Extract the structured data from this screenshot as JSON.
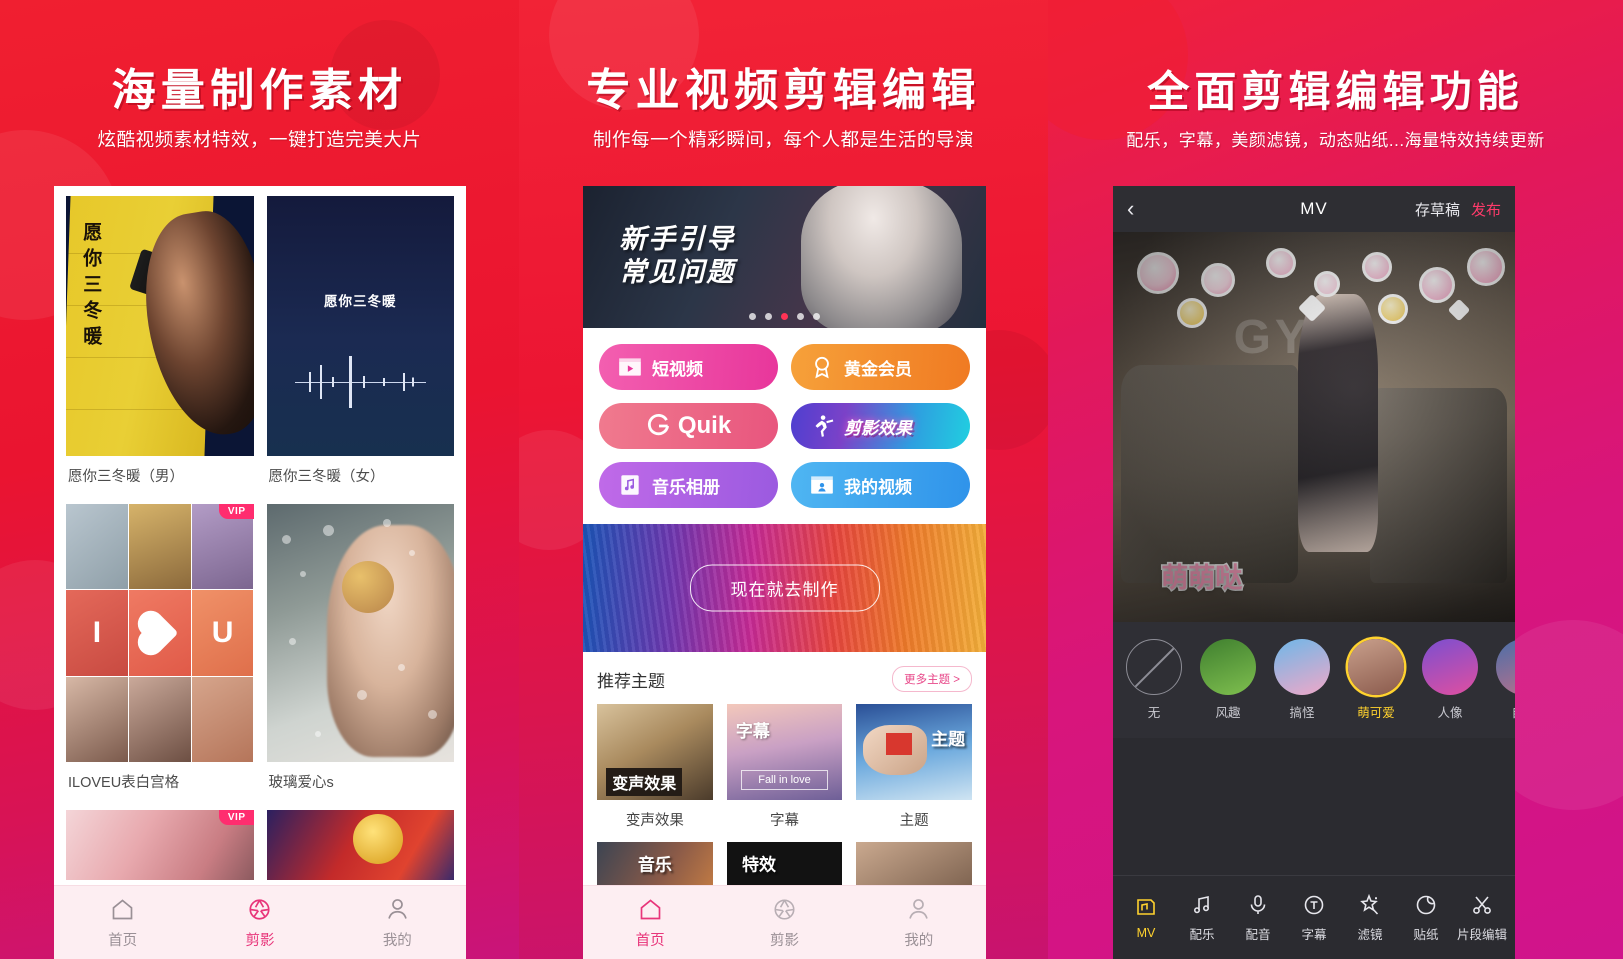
{
  "panels": [
    {
      "title": "海量制作素材",
      "subtitle": "炫酷视频素材特效，一键打造完美大片"
    },
    {
      "title": "专业视频剪辑编辑",
      "subtitle": "制作每一个精彩瞬间，每个人都是生活的导演"
    },
    {
      "title": "全面剪辑编辑功能",
      "subtitle": "配乐，字幕，美颜滤镜，动态贴纸...海量特效持续更新"
    }
  ],
  "phone1": {
    "cards": [
      {
        "caption": "愿你三冬暖（男）",
        "vip": ""
      },
      {
        "caption": "愿你三冬暖（女）",
        "vip": ""
      },
      {
        "caption": "ILOVEU表白宫格",
        "vip": "VIP"
      },
      {
        "caption": "玻璃爱心s",
        "vip": ""
      }
    ],
    "wave_title": "愿你三冬暖",
    "calligraphy": "愿你三冬暖",
    "collage_letters": [
      "I",
      "U"
    ],
    "partial_cards": [
      {
        "vip": "VIP"
      },
      {
        "vip": ""
      }
    ],
    "tabs": [
      {
        "label": "首页",
        "icon": "home-icon",
        "active": false
      },
      {
        "label": "剪影",
        "icon": "aperture-icon",
        "active": true
      },
      {
        "label": "我的",
        "icon": "user-icon",
        "active": false
      }
    ]
  },
  "phone2": {
    "banner": {
      "line1": "新手引导",
      "line2": "常见问题",
      "dots": 5,
      "active_dot": 3
    },
    "buttons": [
      {
        "label": "短视频",
        "icon": "video-clapper-icon",
        "style": "b-pink"
      },
      {
        "label": "黄金会员",
        "icon": "medal-icon",
        "style": "b-orange"
      },
      {
        "label": "Quik",
        "icon": "quik-logo-icon",
        "style": "b-rose"
      },
      {
        "label": "剪影效果",
        "icon": "dancer-icon",
        "style": "b-blue"
      },
      {
        "label": "音乐相册",
        "icon": "music-album-icon",
        "style": "b-purple"
      },
      {
        "label": "我的视频",
        "icon": "my-video-icon",
        "style": "b-cyan"
      }
    ],
    "make_button": "现在就去制作",
    "themes_title": "推荐主题",
    "more_themes": "更多主题 >",
    "themes": [
      {
        "caption": "变声效果",
        "overlay": "变声效果"
      },
      {
        "caption": "字幕",
        "overlay": "字幕",
        "sub": "Fall in love"
      },
      {
        "caption": "主题",
        "overlay": "主题"
      }
    ],
    "themes_row2": [
      {
        "overlay": "音乐"
      },
      {
        "overlay": "特效"
      },
      {
        "overlay": ""
      }
    ],
    "tabs": [
      {
        "label": "首页",
        "icon": "home-icon",
        "active": true
      },
      {
        "label": "剪影",
        "icon": "aperture-icon",
        "active": false
      },
      {
        "label": "我的",
        "icon": "user-icon",
        "active": false
      }
    ]
  },
  "phone3": {
    "topbar": {
      "back": "‹",
      "title": "MV",
      "save_draft": "存草稿",
      "publish": "发布"
    },
    "video": {
      "sticker_text": "萌萌哒",
      "watermark": "GYM"
    },
    "filters": [
      {
        "label": "无",
        "active": false
      },
      {
        "label": "风趣",
        "active": false
      },
      {
        "label": "搞怪",
        "active": false
      },
      {
        "label": "萌可爱",
        "active": true
      },
      {
        "label": "人像",
        "active": false
      },
      {
        "label": "自拍",
        "active": false
      }
    ],
    "tools": [
      {
        "label": "MV",
        "icon": "mv-icon",
        "active": true
      },
      {
        "label": "配乐",
        "icon": "music-note-icon",
        "active": false
      },
      {
        "label": "配音",
        "icon": "microphone-icon",
        "active": false
      },
      {
        "label": "字幕",
        "icon": "text-circle-icon",
        "active": false
      },
      {
        "label": "滤镜",
        "icon": "magic-wand-icon",
        "active": false
      },
      {
        "label": "贴纸",
        "icon": "sticker-icon",
        "active": false
      },
      {
        "label": "片段编辑",
        "icon": "scissors-icon",
        "active": false
      }
    ]
  },
  "colors": {
    "brand_red": "#e8142a",
    "brand_pink": "#d0148c",
    "accent_pink": "#e8357a",
    "accent_yellow": "#ffd22e",
    "publish_red": "#ff3b6b"
  }
}
